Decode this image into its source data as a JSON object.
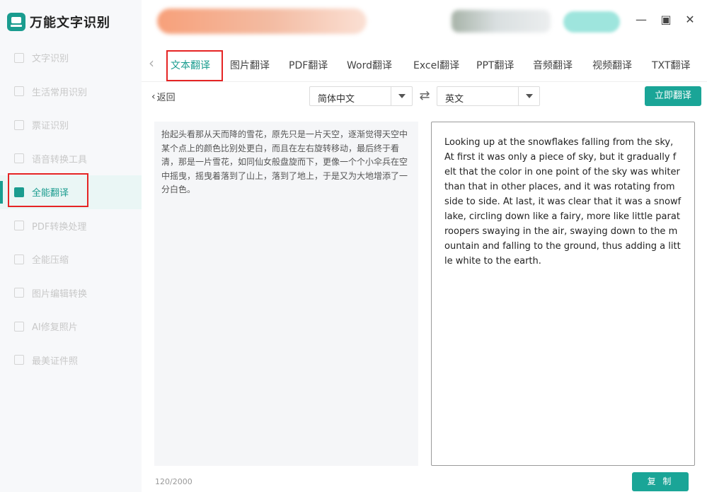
{
  "app": {
    "title": "万能文字识别"
  },
  "sidebar": {
    "items": [
      {
        "label": "文字识别",
        "icon": "scan-text-icon",
        "active": false
      },
      {
        "label": "生活常用识别",
        "icon": "scan-life-icon",
        "active": false
      },
      {
        "label": "票证识别",
        "icon": "ticket-scan-icon",
        "active": false
      },
      {
        "label": "语音转换工具",
        "icon": "voice-icon",
        "active": false
      },
      {
        "label": "全能翻译",
        "icon": "translate-icon",
        "active": true
      },
      {
        "label": "PDF转换处理",
        "icon": "pdf-icon",
        "active": false
      },
      {
        "label": "全能压缩",
        "icon": "compress-icon",
        "active": false
      },
      {
        "label": "图片编辑转换",
        "icon": "image-edit-icon",
        "active": false
      },
      {
        "label": "AI修复照片",
        "icon": "ai-photo-icon",
        "active": false
      },
      {
        "label": "最美证件照",
        "icon": "id-photo-icon",
        "active": false
      }
    ]
  },
  "tabs": [
    {
      "label": "文本翻译",
      "active": true
    },
    {
      "label": "图片翻译",
      "active": false
    },
    {
      "label": "PDF翻译",
      "active": false
    },
    {
      "label": "Word翻译",
      "active": false
    },
    {
      "label": "Excel翻译",
      "active": false
    },
    {
      "label": "PPT翻译",
      "active": false
    },
    {
      "label": "音频翻译",
      "active": false
    },
    {
      "label": "视频翻译",
      "active": false
    },
    {
      "label": "TXT翻译",
      "active": false
    }
  ],
  "toolbar": {
    "back_label": "返回",
    "source_lang": "简体中文",
    "target_lang": "英文",
    "translate_label": "立即翻译"
  },
  "source": {
    "text": "抬起头看那从天而降的雪花，原先只是一片天空，逐渐觉得天空中某个点上的颜色比别处更白，而且在左右旋转移动，最后终于看清，那是一片雪花，如同仙女般盘旋而下，更像一个个小伞兵在空中摇曳，摇曳着落到了山上，落到了地上，于是又为大地增添了一分白色。",
    "counter": "120/2000"
  },
  "result": {
    "text": "Looking up at the snowflakes falling from the sky, At first it was only a piece of sky, but it gradually felt that the color in one point of the sky was whiter than that in other places, and it was rotating from side to side. At last, it was clear that it was a snowflake, circling down like a fairy, more like little paratroopers swaying in the air, swaying down to the mountain and falling to the ground, thus adding a little white to the earth.",
    "copy_label": "复 制"
  },
  "colors": {
    "accent": "#1aa597",
    "highlight": "#e52424"
  }
}
